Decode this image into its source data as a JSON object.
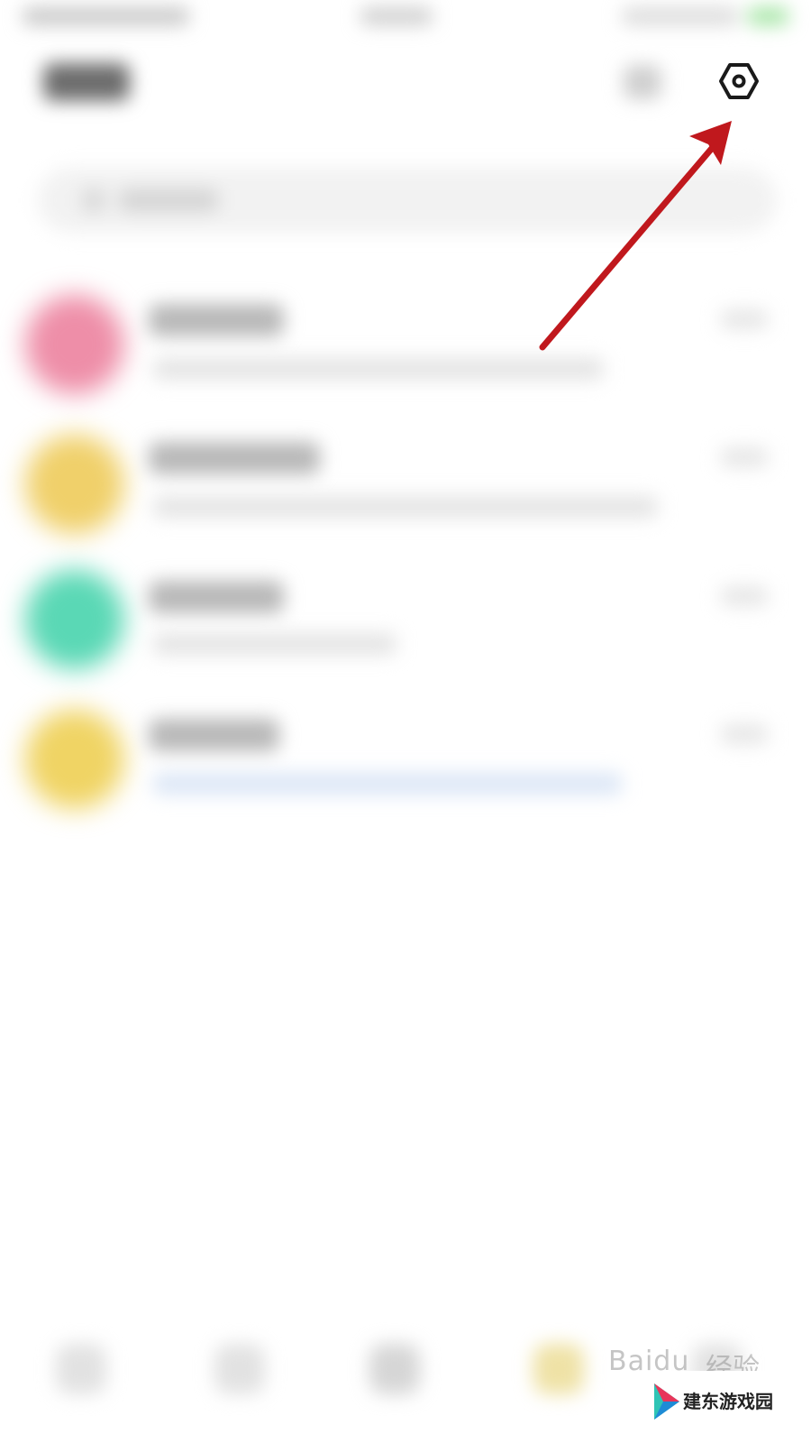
{
  "status_bar": {
    "blurred": true
  },
  "header": {
    "settings_icon": "hexagon-settings-icon"
  },
  "search": {
    "icon": "search-icon"
  },
  "conversations": [
    {
      "avatar_color": "#ee8ea8"
    },
    {
      "avatar_color": "#f0d06a"
    },
    {
      "avatar_color": "#5ad8b5"
    },
    {
      "avatar_color": "#f0d464"
    }
  ],
  "bottom_nav": {
    "items": 5
  },
  "annotation": {
    "arrow_color": "#c0181d",
    "points_to": "settings-button"
  },
  "watermark": {
    "baidu_text": "Baidu",
    "jingyan_text": "经验",
    "site_text": "建东游戏园"
  },
  "colors": {
    "icon_dark": "#1a1a1a",
    "background": "#ffffff"
  }
}
